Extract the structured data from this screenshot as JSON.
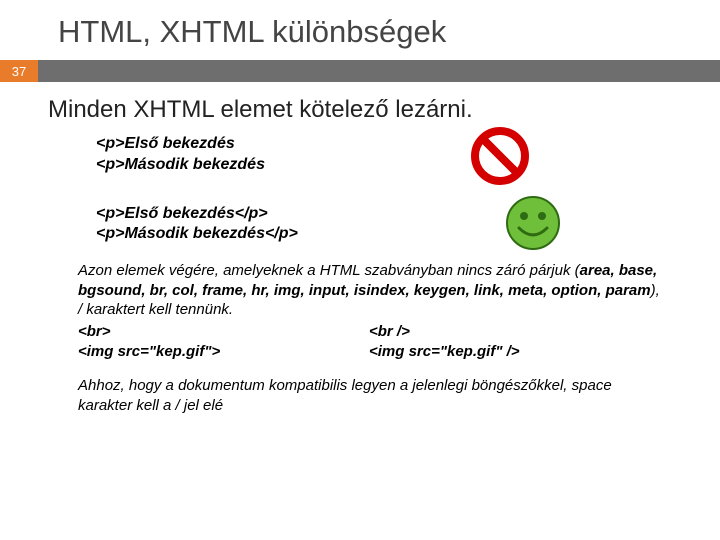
{
  "title": "HTML, XHTML különbségek",
  "page_number": "37",
  "subheading": "Minden XHTML elemet kötelező lezárni.",
  "wrong_example": {
    "line1": "<p>Első bekezdés",
    "line2": "<p>Második bekezdés"
  },
  "correct_example": {
    "line1": "<p>Első bekezdés</p>",
    "line2": "<p>Második bekezdés</p>"
  },
  "explanation_intro": "Azon elemek végére, amelyeknek a HTML szabványban nincs záró párjuk (",
  "self_closing_list": "area, base, bgsound, br, col, frame, hr, img, input, isindex, keygen, link, meta, option, param",
  "explanation_outro": "), / karaktert kell tennünk.",
  "left_col": {
    "l1": "<br>",
    "l2": "<img src=\"kep.gif\">"
  },
  "right_col": {
    "r1": "<br />",
    "r2": "<img src=\"kep.gif\" />"
  },
  "footer": "Ahhoz, hogy a dokumentum kompatibilis legyen a jelenlegi böngészőkkel, space karakter kell a / jel elé",
  "icons": {
    "prohibited": "prohibited-icon",
    "smiley": "smiley-icon"
  }
}
